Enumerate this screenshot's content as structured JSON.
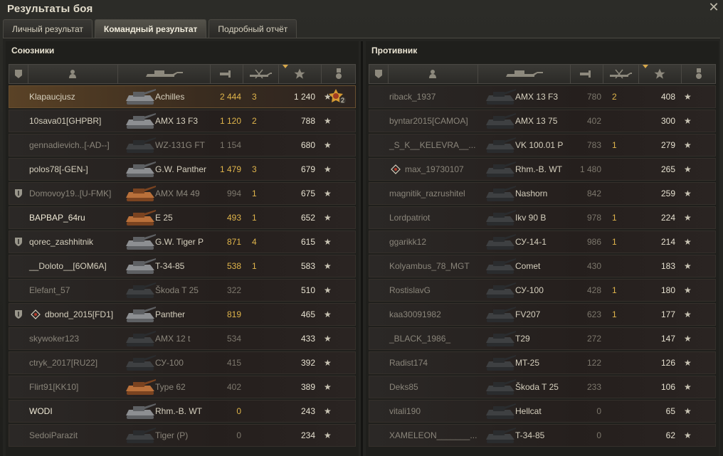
{
  "window": {
    "title": "Результаты боя",
    "close_label": "✕"
  },
  "tabs": [
    {
      "label": "Личный результат",
      "active": false
    },
    {
      "label": "Командный результат",
      "active": true
    },
    {
      "label": "Подробный отчёт",
      "active": false
    }
  ],
  "allies": {
    "title": "Союзники",
    "rows": [
      {
        "player": "Klapaucjusz",
        "tank": "Achilles",
        "damage": "2 444",
        "kills": "3",
        "xp": "1 240",
        "me": true,
        "medal": "2",
        "tank_color": "grey"
      },
      {
        "player": "10sava01[GHPBR]",
        "tank": "AMX 13 F3",
        "damage": "1 120",
        "kills": "2",
        "xp": "788",
        "tank_color": "grey"
      },
      {
        "player": "gennadievich..[-AD--]",
        "tank": "WZ-131G FT",
        "damage": "1 154",
        "kills": "",
        "xp": "680",
        "dim": true,
        "tank_color": "dark"
      },
      {
        "player": "polos78[-GEN-]",
        "tank": "G.W. Panther",
        "damage": "1 479",
        "kills": "3",
        "xp": "679",
        "tank_color": "grey"
      },
      {
        "player": "Domovoy19..[U-FMK]",
        "tank": "AMX M4 49",
        "damage": "994",
        "kills": "1",
        "xp": "675",
        "dim": true,
        "shield": true,
        "tank_color": "orange"
      },
      {
        "player": "BAPBAP_64ru",
        "tank": "E 25",
        "damage": "493",
        "kills": "1",
        "xp": "652",
        "tank_color": "orange",
        "bright": true
      },
      {
        "player": "qorec_zashhitnik",
        "tank": "G.W. Tiger P",
        "damage": "871",
        "kills": "4",
        "xp": "615",
        "shield": true,
        "tank_color": "grey"
      },
      {
        "player": "__Doloto__[6OM6A]",
        "tank": "T-34-85",
        "damage": "538",
        "kills": "1",
        "xp": "583",
        "tank_color": "grey"
      },
      {
        "player": "Elefant_57",
        "tank": "Škoda T 25",
        "damage": "322",
        "kills": "",
        "xp": "510",
        "dim": true,
        "tank_color": "dark"
      },
      {
        "player": "dbond_2015[FD1]",
        "tank": "Panther",
        "damage": "819",
        "kills": "",
        "xp": "465",
        "shield": true,
        "diamond": true,
        "tank_color": "grey"
      },
      {
        "player": "skywoker123",
        "tank": "AMX 12 t",
        "damage": "534",
        "kills": "",
        "xp": "433",
        "dim": true,
        "tank_color": "dark"
      },
      {
        "player": "ctryk_2017[RU22]",
        "tank": "СУ-100",
        "damage": "415",
        "kills": "",
        "xp": "392",
        "dim": true,
        "tank_color": "dark"
      },
      {
        "player": "Flirt91[KK10]",
        "tank": "Type 62",
        "damage": "402",
        "kills": "",
        "xp": "389",
        "dim": true,
        "tank_color": "orange"
      },
      {
        "player": "WODI",
        "tank": "Rhm.-B. WT",
        "damage": "0",
        "kills": "",
        "xp": "243",
        "bright": true,
        "tank_color": "grey"
      },
      {
        "player": "SedoiParazit",
        "tank": "Tiger (P)",
        "damage": "0",
        "kills": "",
        "xp": "234",
        "dim": true,
        "tank_color": "dark"
      }
    ]
  },
  "enemies": {
    "title": "Противник",
    "rows": [
      {
        "player": "riback_1937",
        "tank": "AMX 13 F3",
        "damage": "780",
        "kills": "2",
        "xp": "408",
        "dim": true
      },
      {
        "player": "byntar2015[CAMOA]",
        "tank": "AMX 13 75",
        "damage": "402",
        "kills": "",
        "xp": "300",
        "dim": true
      },
      {
        "player": "_S_K__KELEVRA__...",
        "tank": "VK 100.01 P",
        "damage": "783",
        "kills": "1",
        "xp": "279",
        "dim": true
      },
      {
        "player": "max_19730107",
        "tank": "Rhm.-B. WT",
        "damage": "1 480",
        "kills": "",
        "xp": "265",
        "dim": true,
        "diamond": true
      },
      {
        "player": "magnitik_razrushitel",
        "tank": "Nashorn",
        "damage": "842",
        "kills": "",
        "xp": "259",
        "dim": true
      },
      {
        "player": "Lordpatriot",
        "tank": "Ikv 90 B",
        "damage": "978",
        "kills": "1",
        "xp": "224",
        "dim": true
      },
      {
        "player": "ggarikk12",
        "tank": "СУ-14-1",
        "damage": "986",
        "kills": "1",
        "xp": "214",
        "dim": true
      },
      {
        "player": "Kolyambus_78_MGT",
        "tank": "Comet",
        "damage": "430",
        "kills": "",
        "xp": "183",
        "dim": true
      },
      {
        "player": "RostislavG",
        "tank": "СУ-100",
        "damage": "428",
        "kills": "1",
        "xp": "180",
        "dim": true
      },
      {
        "player": "kaa30091982",
        "tank": "FV207",
        "damage": "623",
        "kills": "1",
        "xp": "177",
        "dim": true
      },
      {
        "player": "_BLACK_1986_",
        "tank": "T29",
        "damage": "272",
        "kills": "",
        "xp": "147",
        "dim": true
      },
      {
        "player": "Radist174",
        "tank": "MT-25",
        "damage": "122",
        "kills": "",
        "xp": "126",
        "dim": true
      },
      {
        "player": "Deks85",
        "tank": "Škoda T 25",
        "damage": "233",
        "kills": "",
        "xp": "106",
        "dim": true
      },
      {
        "player": "vitali190",
        "tank": "Hellcat",
        "damage": "0",
        "kills": "",
        "xp": "65",
        "dim": true
      },
      {
        "player": "XAMELEON_______...",
        "tank": "T-34-85",
        "damage": "0",
        "kills": "",
        "xp": "62",
        "dim": true
      }
    ]
  },
  "icons": {
    "star": "★",
    "shield": "shield-icon",
    "diamond": "diamond-icon"
  },
  "colors": {
    "gold": "#e0b54b",
    "me_row": "#5a4226"
  }
}
